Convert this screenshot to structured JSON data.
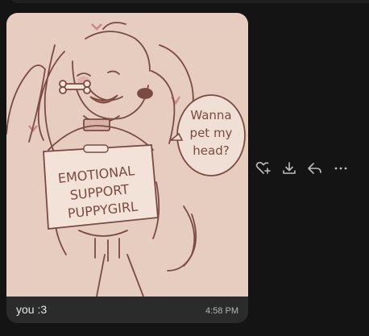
{
  "message": {
    "caption": "you :3",
    "time": "4:58 PM",
    "image": {
      "speech_bubble": [
        "Wanna",
        "pet my",
        "head?"
      ],
      "sign": [
        "EMOTIONAL",
        "SUPPORT",
        "PUPPYGIRL"
      ]
    }
  },
  "actions": [
    {
      "name": "react",
      "icon": "heart-plus-icon"
    },
    {
      "name": "download",
      "icon": "download-icon"
    },
    {
      "name": "reply",
      "icon": "reply-icon"
    },
    {
      "name": "more",
      "icon": "more-horizontal-icon"
    }
  ],
  "colors": {
    "background": "#141414",
    "card": "#2b2b2b",
    "artwork_bg": "#e6cdbf",
    "line_art": "#7b4b43",
    "icon": "#bdbdbd"
  }
}
